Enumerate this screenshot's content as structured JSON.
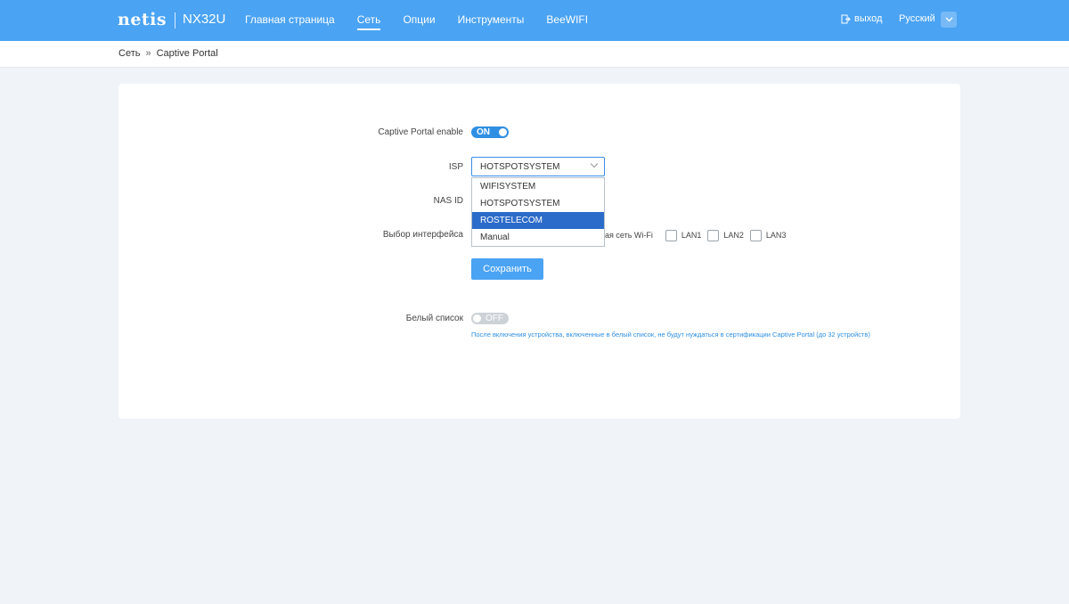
{
  "header": {
    "brand": "netis",
    "model": "NX32U",
    "nav": [
      {
        "label": "Главная страница",
        "active": false
      },
      {
        "label": "Сеть",
        "active": true
      },
      {
        "label": "Опции",
        "active": false
      },
      {
        "label": "Инструменты",
        "active": false
      },
      {
        "label": "BeeWIFI",
        "active": false
      }
    ],
    "logout_label": "выход",
    "language": "Русский"
  },
  "breadcrumb": {
    "root": "Сеть",
    "separator": "»",
    "current": "Captive Portal"
  },
  "form": {
    "captive_portal_label": "Captive Portal enable",
    "captive_portal_state": "ON",
    "isp_label": "ISP",
    "isp_value": "HOTSPOTSYSTEM",
    "isp_options": [
      {
        "label": "WIFISYSTEM",
        "highlighted": false
      },
      {
        "label": "HOTSPOTSYSTEM",
        "highlighted": false
      },
      {
        "label": "ROSTELECOM",
        "highlighted": true
      },
      {
        "label": "Manual",
        "highlighted": false
      }
    ],
    "nas_id_label": "NAS ID",
    "interface_label": "Выбор интерфейса",
    "interface_wifi_text": "ая сеть Wi-Fi",
    "interfaces": [
      "LAN1",
      "LAN2",
      "LAN3"
    ],
    "save_label": "Сохранить",
    "whitelist_label": "Белый список",
    "whitelist_state": "OFF",
    "whitelist_note": "После включения устройства, включенные в белый список, не будут нуждаться в сертификации Captive Portal (до 32 устройств)"
  },
  "colors": {
    "header_bg": "#4aa3f3",
    "accent": "#2f8fe3",
    "highlight": "#2b6bc9"
  }
}
